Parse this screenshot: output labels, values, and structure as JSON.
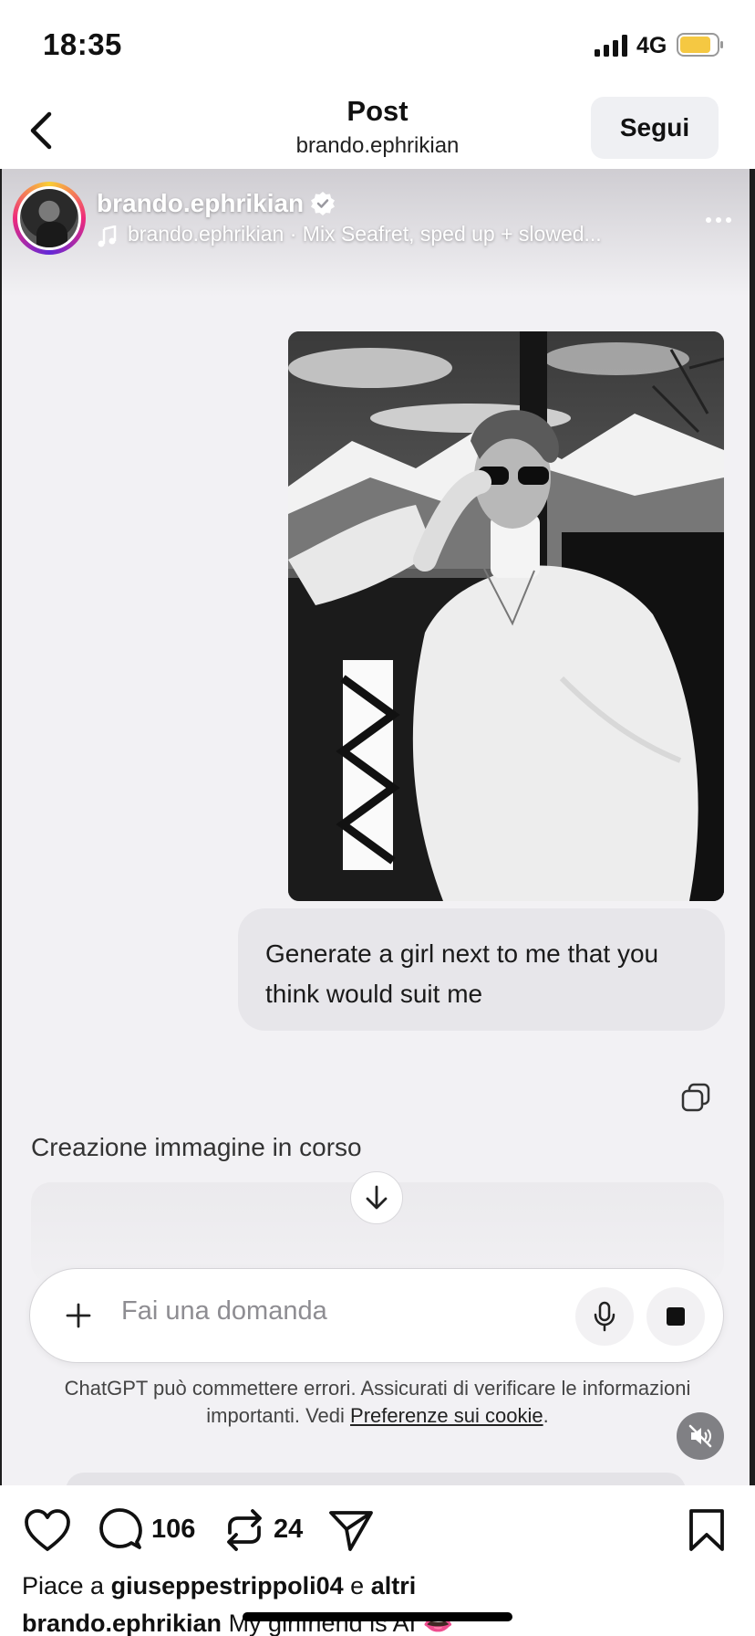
{
  "status_bar": {
    "time": "18:35",
    "network": "4G",
    "icons": [
      "signal-icon",
      "battery-icon"
    ],
    "battery_color": "#f5c842"
  },
  "header": {
    "title": "Post",
    "subtitle": "brando.ephrikian",
    "follow_label": "Segui"
  },
  "post": {
    "username": "brando.ephrikian",
    "audio": "brando.ephrikian · Mix  Seafret, sped up + slowed...",
    "chat": {
      "user_message": "Generate a girl next to me that you think would suit me",
      "status": "Creazione immagine in corso",
      "input_placeholder": "Fai una domanda",
      "disclaimer_text": "ChatGPT può commettere errori. Assicurati di verificare le informazioni importanti. Vedi",
      "disclaimer_link": "Preferenze sui cookie",
      "disclaimer_end": "."
    }
  },
  "actions": {
    "comments": "106",
    "reposts": "24"
  },
  "likes": {
    "prefix": "Piace a",
    "user": "giuseppestrippoli04",
    "joiner": "e",
    "others": "altri"
  },
  "caption": {
    "user": "brando.ephrikian",
    "text": "My girlfriend is AI 👄"
  },
  "colors": {
    "follow_bg": "#eff0f3",
    "chat_bg": "#f2f1f4",
    "bubble_bg": "#e7e6ea"
  }
}
